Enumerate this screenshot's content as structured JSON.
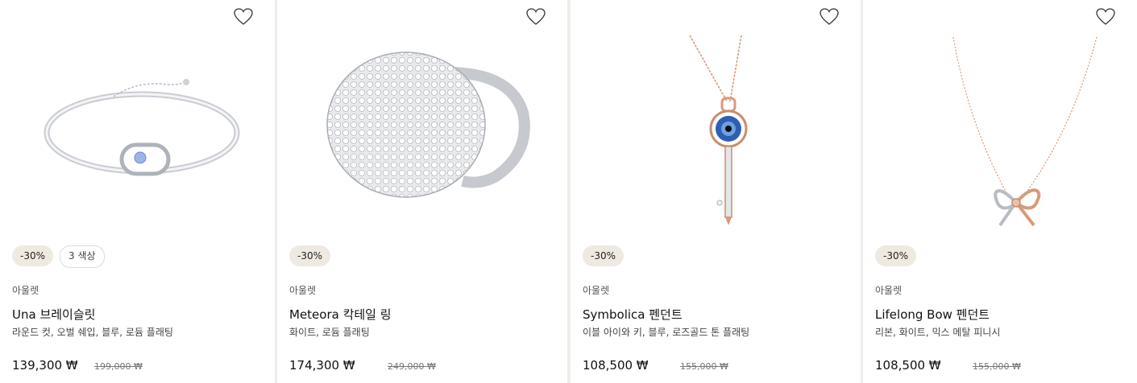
{
  "products": [
    {
      "badges": [
        "-30%",
        "3 색상"
      ],
      "category": "아울렛",
      "name": "Una 브레이슬릿",
      "description": "라운드 컷, 오벌 쉐입, 블루, 로듐 플래팅",
      "price": "139,300 ₩",
      "original_price": "199,000 ₩",
      "image_icon": "bracelet-image"
    },
    {
      "badges": [
        "-30%"
      ],
      "category": "아울렛",
      "name": "Meteora 칵테일 링",
      "description": "화이트, 로듐 플래팅",
      "price": "174,300 ₩",
      "original_price": "249,000 ₩",
      "image_icon": "ring-image"
    },
    {
      "badges": [
        "-30%"
      ],
      "category": "아울렛",
      "name": "Symbolica 펜던트",
      "description": "이블 아이와 키, 블루, 로즈골드 톤 플래팅",
      "price": "108,500 ₩",
      "original_price": "155,000 ₩",
      "image_icon": "key-pendant-image"
    },
    {
      "badges": [
        "-30%"
      ],
      "category": "아울렛",
      "name": "Lifelong Bow 펜던트",
      "description": "리본, 화이트, 믹스 메탈 피니시",
      "price": "108,500 ₩",
      "original_price": "155,000 ₩",
      "image_icon": "bow-pendant-image"
    }
  ],
  "colors": {
    "page_bg": "#efede8",
    "badge_bg": "#efeae1",
    "rose_gold": "#d89a7a"
  }
}
